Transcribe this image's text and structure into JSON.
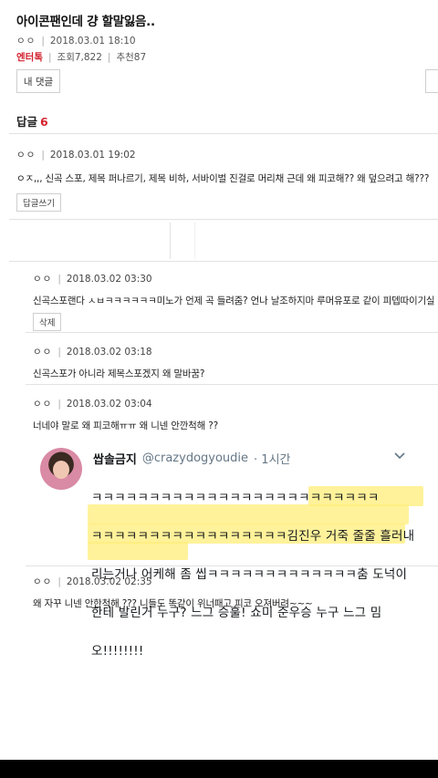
{
  "post": {
    "title": "아이콘팬인데 걍 할말잃음..",
    "author": "ㅇㅇ",
    "datetime": "2018.03.01 18:10",
    "category": "엔터톡",
    "views": "조회7,822",
    "recommend": "추천87"
  },
  "buttons": {
    "my_comments": "내 댓글"
  },
  "replies": {
    "label": "답글",
    "count": "6"
  },
  "comments": [
    {
      "author": "ㅇㅇ",
      "datetime": "2018.03.01 19:02",
      "text": "ㅇㅈ,,, 신곡 스포, 제목 퍼나르기, 제목 비하, 서바이벌 진걸로 머리채 근데 왜 피코해?? 왜 덮으려고 해???",
      "action": "답글쓰기"
    },
    {
      "author": "ㅇㅇ",
      "datetime": "2018.03.02 03:30",
      "text": "신곡스포랜다 ㅅㅂㅋㅋㅋㅋㅋㅋ미노가 언제 곡 들려줌? 언나 날조하지마 루머유포로 같이 피뎁따이기실",
      "action": "삭제"
    },
    {
      "author": "ㅇㅇ",
      "datetime": "2018.03.02 03:18",
      "text": "신곡스포가 아니라 제목스포겠지 왜 말바꿈?"
    },
    {
      "author": "ㅇㅇ",
      "datetime": "2018.03.02 03:04",
      "text": "너네야 말로 왜 피코해ㅠㅠ 왜 니넨 안깐척해 ??"
    },
    {
      "author": "ㅇㅇ",
      "datetime": "2018.03.02 02:35",
      "text": "왜 자꾸 니넨 안한척해 ??? 니들도 똑같이 위너패고 피코 오져버려~~~"
    }
  ],
  "tweet": {
    "name": "쌉솔금지",
    "handle": "@crazydogyoudie",
    "time": "· 1시간",
    "chevron_icon": "chevron-down-icon",
    "lines": [
      "ㅋㅋㅋㅋㅋㅋㅋㅋㅋㅋㅋㅋㅋㅋㅋㅋㅋㅋㅋㅋㅋㅋㅋㅋㅋ",
      "ㅋㅋㅋㅋㅋㅋㅋㅋㅋㅋㅋㅋㅋㅋㅋㅋㅋ김진우 거죽 줄줄 흘러내",
      "리는거나 어케해 좀 씹ㅋㅋㅋㅋㅋㅋㅋㅋㅋㅋㅋㅋㅋ춤 도넉이",
      "한테 발린거 누구? 느그 승훌! 쇼미 준우승 누구 느그 밈",
      "오!!!!!!!!"
    ],
    "highlight_color": "#ffee78"
  },
  "colors": {
    "accent_red": "#d3232f",
    "border": "#cfcfcf"
  }
}
